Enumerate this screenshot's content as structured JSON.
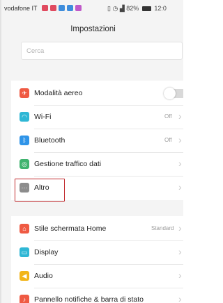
{
  "status_bar": {
    "carrier": "vodafone IT",
    "battery_percent": "82%",
    "time": "12:0"
  },
  "header": {
    "title": "Impostazioni"
  },
  "search": {
    "placeholder": "Cerca"
  },
  "sections": [
    {
      "rows": [
        {
          "label": "Modalità aereo",
          "type": "toggle",
          "toggle_on": false,
          "icon": "airplane-icon",
          "color": "#ef5a43"
        },
        {
          "label": "Wi-Fi",
          "value": "Off",
          "icon": "wifi-icon",
          "color": "#2fb7d5"
        },
        {
          "label": "Bluetooth",
          "value": "Off",
          "icon": "bluetooth-icon",
          "color": "#2f94e8"
        },
        {
          "label": "Gestione traffico dati",
          "icon": "data-traffic-icon",
          "color": "#3fb36e"
        },
        {
          "label": "Altro",
          "icon": "more-icon",
          "color": "#8c8c8c",
          "highlighted": true
        }
      ]
    },
    {
      "rows": [
        {
          "label": "Stile schermata Home",
          "value": "Standard",
          "icon": "home-icon",
          "color": "#ef5a43"
        },
        {
          "label": "Display",
          "icon": "display-icon",
          "color": "#2fb7d5"
        },
        {
          "label": "Audio",
          "icon": "audio-icon",
          "color": "#f2b51a"
        },
        {
          "label": "Pannello notifiche & barra di stato",
          "icon": "notifications-icon",
          "color": "#ef5a43"
        }
      ]
    }
  ],
  "colors": {
    "highlight_border": "#c0282b",
    "background": "#f4f4f4"
  }
}
